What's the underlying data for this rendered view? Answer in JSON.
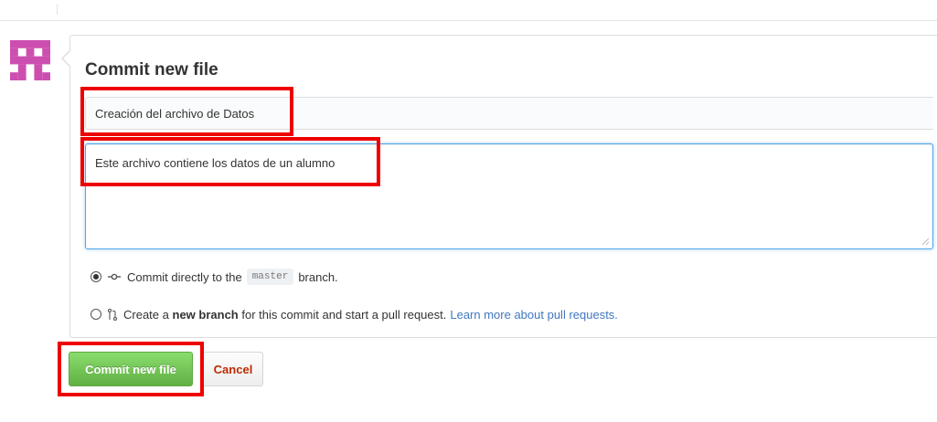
{
  "commit_form": {
    "title": "Commit new file",
    "summary_value": "Creación del archivo de Datos",
    "description_value": "Este archivo contiene los datos de un alumno",
    "option_direct": {
      "prefix": "Commit directly to the",
      "branch": "master",
      "suffix": "branch.",
      "selected": true
    },
    "option_new_branch": {
      "prefix": "Create a",
      "bold": "new branch",
      "suffix": "for this commit and start a pull request.",
      "link": "Learn more about pull requests.",
      "selected": false
    },
    "commit_button_label": "Commit new file",
    "cancel_button_label": "Cancel"
  },
  "icons": {
    "avatar": "identicon-avatar",
    "commit": "git-commit-icon",
    "pull_request": "git-pull-request-icon"
  },
  "colors": {
    "highlight": "#ee0000",
    "commit_button": "#60b044",
    "cancel_text": "#bd2c00",
    "link": "#4078c0",
    "avatar": "#cc4fb0"
  }
}
